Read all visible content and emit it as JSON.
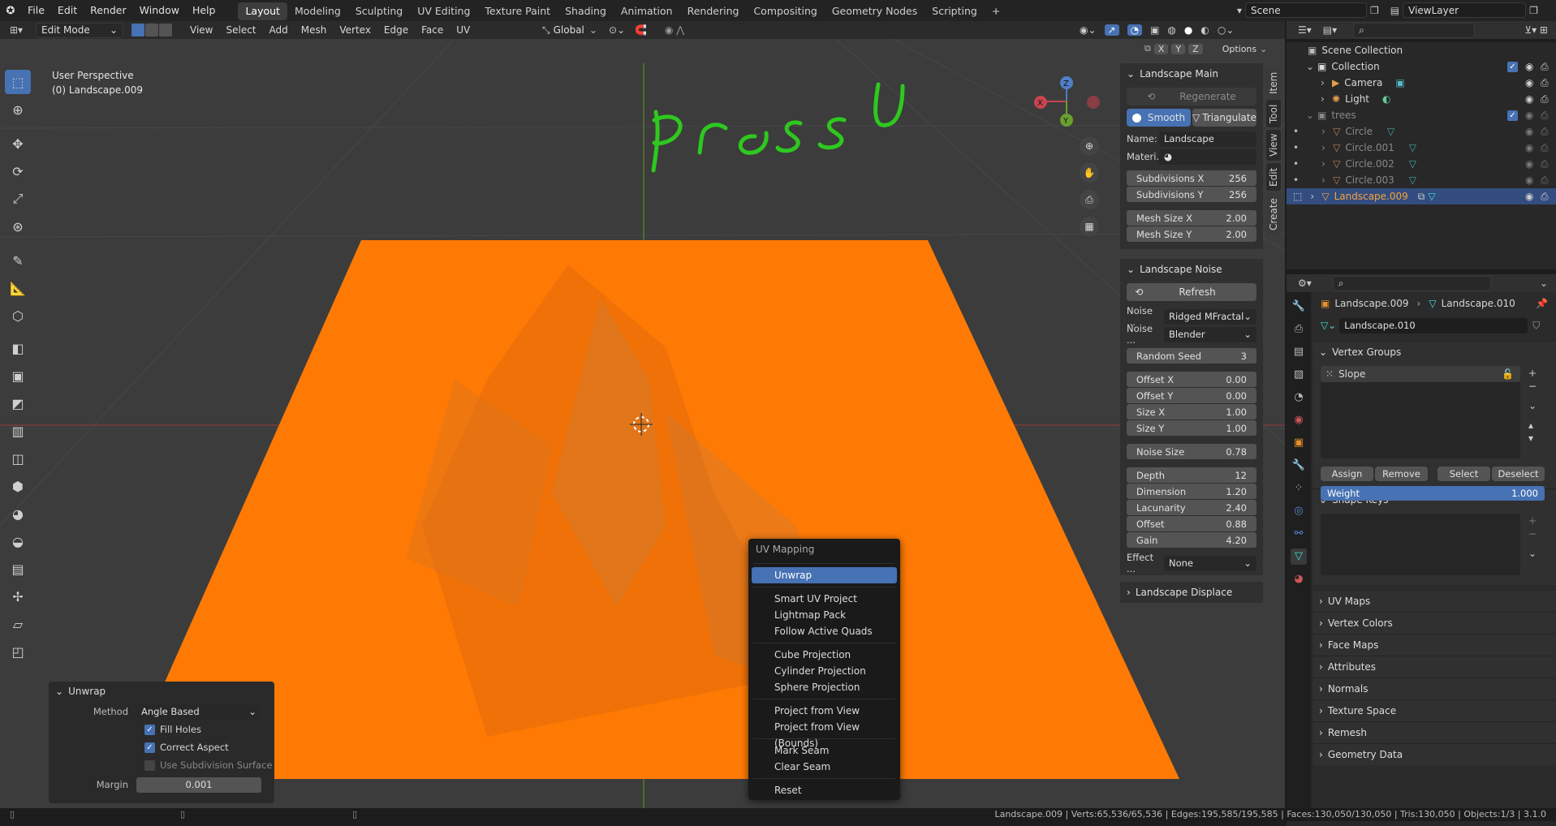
{
  "topbar": {
    "menus": [
      "File",
      "Edit",
      "Render",
      "Window",
      "Help"
    ],
    "workspaces": [
      "Layout",
      "Modeling",
      "Sculpting",
      "UV Editing",
      "Texture Paint",
      "Shading",
      "Animation",
      "Rendering",
      "Compositing",
      "Geometry Nodes",
      "Scripting"
    ],
    "active_workspace": "Layout",
    "scene": "Scene",
    "view_layer": "ViewLayer"
  },
  "header": {
    "mode": "Edit Mode",
    "menus": [
      "View",
      "Select",
      "Add",
      "Mesh",
      "Vertex",
      "Edge",
      "Face",
      "UV"
    ],
    "orientation": "Global",
    "axes": [
      "X",
      "Y",
      "Z"
    ],
    "options": "Options"
  },
  "viewport": {
    "perspective": "User Perspective",
    "object": "(0) Landscape.009",
    "annotation": "Press U",
    "gizmo": {
      "x": "X",
      "y": "Y",
      "z": "Z"
    }
  },
  "npanel": {
    "tabs": [
      "Item",
      "Tool",
      "View",
      "Edit",
      "Create"
    ],
    "landscape_main": {
      "title": "Landscape Main",
      "regenerate": "Regenerate",
      "smooth": "Smooth",
      "triangulate": "Triangulate",
      "name_label": "Name:",
      "name_value": "Landscape",
      "material_label": "Materi...",
      "subdiv_x_label": "Subdivisions X",
      "subdiv_x": "256",
      "subdiv_y_label": "Subdivisions Y",
      "subdiv_y": "256",
      "mesh_x_label": "Mesh Size X",
      "mesh_x": "2.00",
      "mesh_y_label": "Mesh Size Y",
      "mesh_y": "2.00"
    },
    "landscape_noise": {
      "title": "Landscape Noise",
      "refresh": "Refresh",
      "noise_type_label": "Noise ...",
      "noise_type": "Ridged MFractal",
      "noise_basis_label": "Noise ...",
      "noise_basis": "Blender",
      "seed_label": "Random Seed",
      "seed": "3",
      "offx_label": "Offset X",
      "offx": "0.00",
      "offy_label": "Offset Y",
      "offy": "0.00",
      "sizex_label": "Size X",
      "sizex": "1.00",
      "sizey_label": "Size Y",
      "sizey": "1.00",
      "noise_size_label": "Noise Size",
      "noise_size": "0.78",
      "depth_label": "Depth",
      "depth": "12",
      "dimension_label": "Dimension",
      "dimension": "1.20",
      "lacunarity_label": "Lacunarity",
      "lacunarity": "2.40",
      "offset_label": "Offset",
      "offset": "0.88",
      "gain_label": "Gain",
      "gain": "4.20",
      "effect_label": "Effect ...",
      "effect": "None"
    },
    "landscape_displace": "Landscape Displace"
  },
  "outliner": {
    "root": "Scene Collection",
    "collection": "Collection",
    "camera": "Camera",
    "light": "Light",
    "trees": "trees",
    "circles": [
      "Circle",
      "Circle.001",
      "Circle.002",
      "Circle.003"
    ],
    "selected": "Landscape.009"
  },
  "properties": {
    "breadcrumb_object": "Landscape.009",
    "breadcrumb_mesh": "Landscape.010",
    "mesh_name": "Landscape.010",
    "vertex_groups": "Vertex Groups",
    "group": "Slope",
    "assign": "Assign",
    "remove": "Remove",
    "select": "Select",
    "deselect": "Deselect",
    "weight_label": "Weight",
    "weight": "1.000",
    "shape_keys": "Shape Keys",
    "sections": [
      "UV Maps",
      "Vertex Colors",
      "Face Maps",
      "Attributes",
      "Normals",
      "Texture Space",
      "Remesh",
      "Geometry Data"
    ]
  },
  "uv_menu": {
    "title": "UV Mapping",
    "groups": [
      [
        "Unwrap"
      ],
      [
        "Smart UV Project",
        "Lightmap Pack",
        "Follow Active Quads"
      ],
      [
        "Cube Projection",
        "Cylinder Projection",
        "Sphere Projection"
      ],
      [
        "Project from View",
        "Project from View (Bounds)"
      ],
      [
        "Mark Seam",
        "Clear Seam"
      ],
      [
        "Reset"
      ]
    ]
  },
  "redo_panel": {
    "title": "Unwrap",
    "method_label": "Method",
    "method": "Angle Based",
    "fill_holes": "Fill Holes",
    "correct_aspect": "Correct Aspect",
    "use_subsurf": "Use Subdivision Surface",
    "margin_label": "Margin",
    "margin": "0.001"
  },
  "status": "Landscape.009 | Verts:65,536/65,536 | Edges:195,585/195,585 | Faces:130,050/130,050 | Tris:130,050 | Objects:1/3 | 3.1.0",
  "colors": {
    "accent": "#4772b3",
    "mesh": "#ff7a05",
    "annotation": "#2ec81e",
    "selected_text": "#f5a33a"
  }
}
